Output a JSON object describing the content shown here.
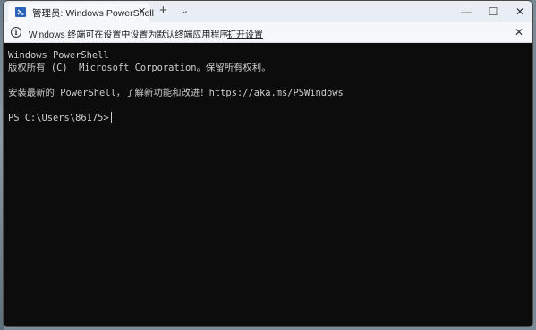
{
  "tab": {
    "title": "管理员: Windows PowerShell",
    "close": "✕"
  },
  "tabbar": {
    "new_tab": "+",
    "dropdown": "⌄"
  },
  "window_controls": {
    "minimize": "—",
    "maximize": "☐",
    "close": "✕"
  },
  "infobar": {
    "message": "Windows 终端可在设置中设置为默认终端应用程序。",
    "link": "打开设置",
    "close": "✕",
    "icon": "i"
  },
  "terminal": {
    "lines": [
      "Windows PowerShell",
      "版权所有 (C)  Microsoft Corporation。保留所有权利。",
      "",
      "安装最新的 PowerShell，了解新功能和改进！https://aka.ms/PSWindows",
      ""
    ],
    "prompt": "PS C:\\Users\\86175>"
  },
  "colors": {
    "terminal_bg": "#0c0c0c",
    "terminal_fg": "#cccccc",
    "tab_icon": "#2a63b8"
  }
}
